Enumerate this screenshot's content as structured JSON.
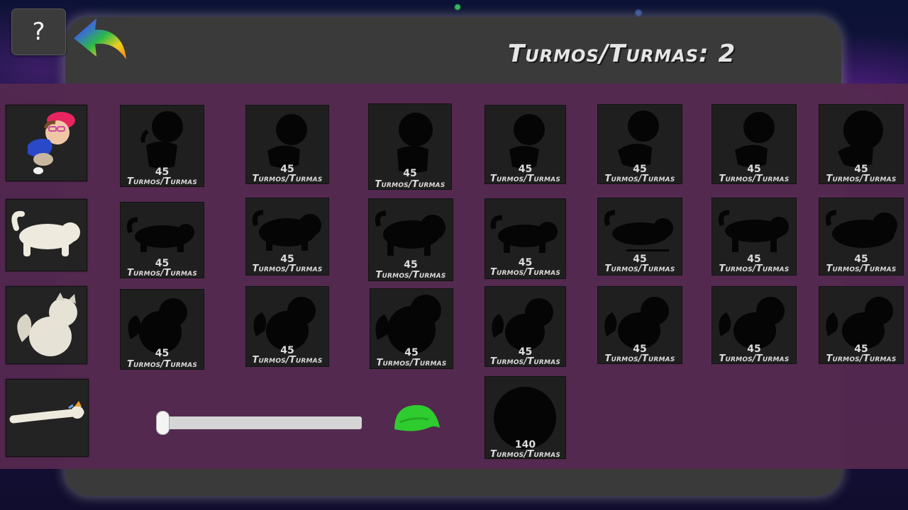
{
  "header": {
    "help_label": "?",
    "back_icon": "rainbow-back-arrow-icon",
    "score_text": "Turmos/Turmas: 2"
  },
  "characters": [
    {
      "name": "boy-with-pink-cap",
      "icon": "boy-character-icon"
    },
    {
      "name": "white-cat",
      "icon": "white-cat-icon"
    },
    {
      "name": "fluffy-cat",
      "icon": "fluffy-cat-icon"
    },
    {
      "name": "long-unicorn-cat",
      "icon": "long-cat-icon"
    }
  ],
  "skins": {
    "row1": [
      {
        "price": "45",
        "currency": "Turmos/Turmas"
      },
      {
        "price": "45",
        "currency": "Turmos/Turmas"
      },
      {
        "price": "45",
        "currency": "Turmos/Turmas"
      },
      {
        "price": "45",
        "currency": "Turmos/Turmas"
      },
      {
        "price": "45",
        "currency": "Turmos/Turmas"
      },
      {
        "price": "45",
        "currency": "Turmos/Turmas"
      },
      {
        "price": "45",
        "currency": "Turmos/Turmas"
      }
    ],
    "row2": [
      {
        "price": "45",
        "currency": "Turmos/Turmas"
      },
      {
        "price": "45",
        "currency": "Turmos/Turmas"
      },
      {
        "price": "45",
        "currency": "Turmos/Turmas"
      },
      {
        "price": "45",
        "currency": "Turmos/Turmas"
      },
      {
        "price": "45",
        "currency": "Turmos/Turmas"
      },
      {
        "price": "45",
        "currency": "Turmos/Turmas"
      },
      {
        "price": "45",
        "currency": "Turmos/Turmas"
      }
    ],
    "row3": [
      {
        "price": "45",
        "currency": "Turmos/Turmas"
      },
      {
        "price": "45",
        "currency": "Turmos/Turmas"
      },
      {
        "price": "45",
        "currency": "Turmos/Turmas"
      },
      {
        "price": "45",
        "currency": "Turmos/Turmas"
      },
      {
        "price": "45",
        "currency": "Turmos/Turmas"
      },
      {
        "price": "45",
        "currency": "Turmos/Turmas"
      },
      {
        "price": "45",
        "currency": "Turmos/Turmas"
      }
    ],
    "row4": [
      {
        "price": "140",
        "currency": "Turmos/Turmas"
      }
    ]
  },
  "controls": {
    "slider_value": 0,
    "hat_icon": "green-cap-icon"
  },
  "colors": {
    "panel": "#3a3a3a",
    "band": "#54284f",
    "tile": "#1f1f1f",
    "silhouette": "#050505",
    "hat": "#2ecc2e"
  }
}
